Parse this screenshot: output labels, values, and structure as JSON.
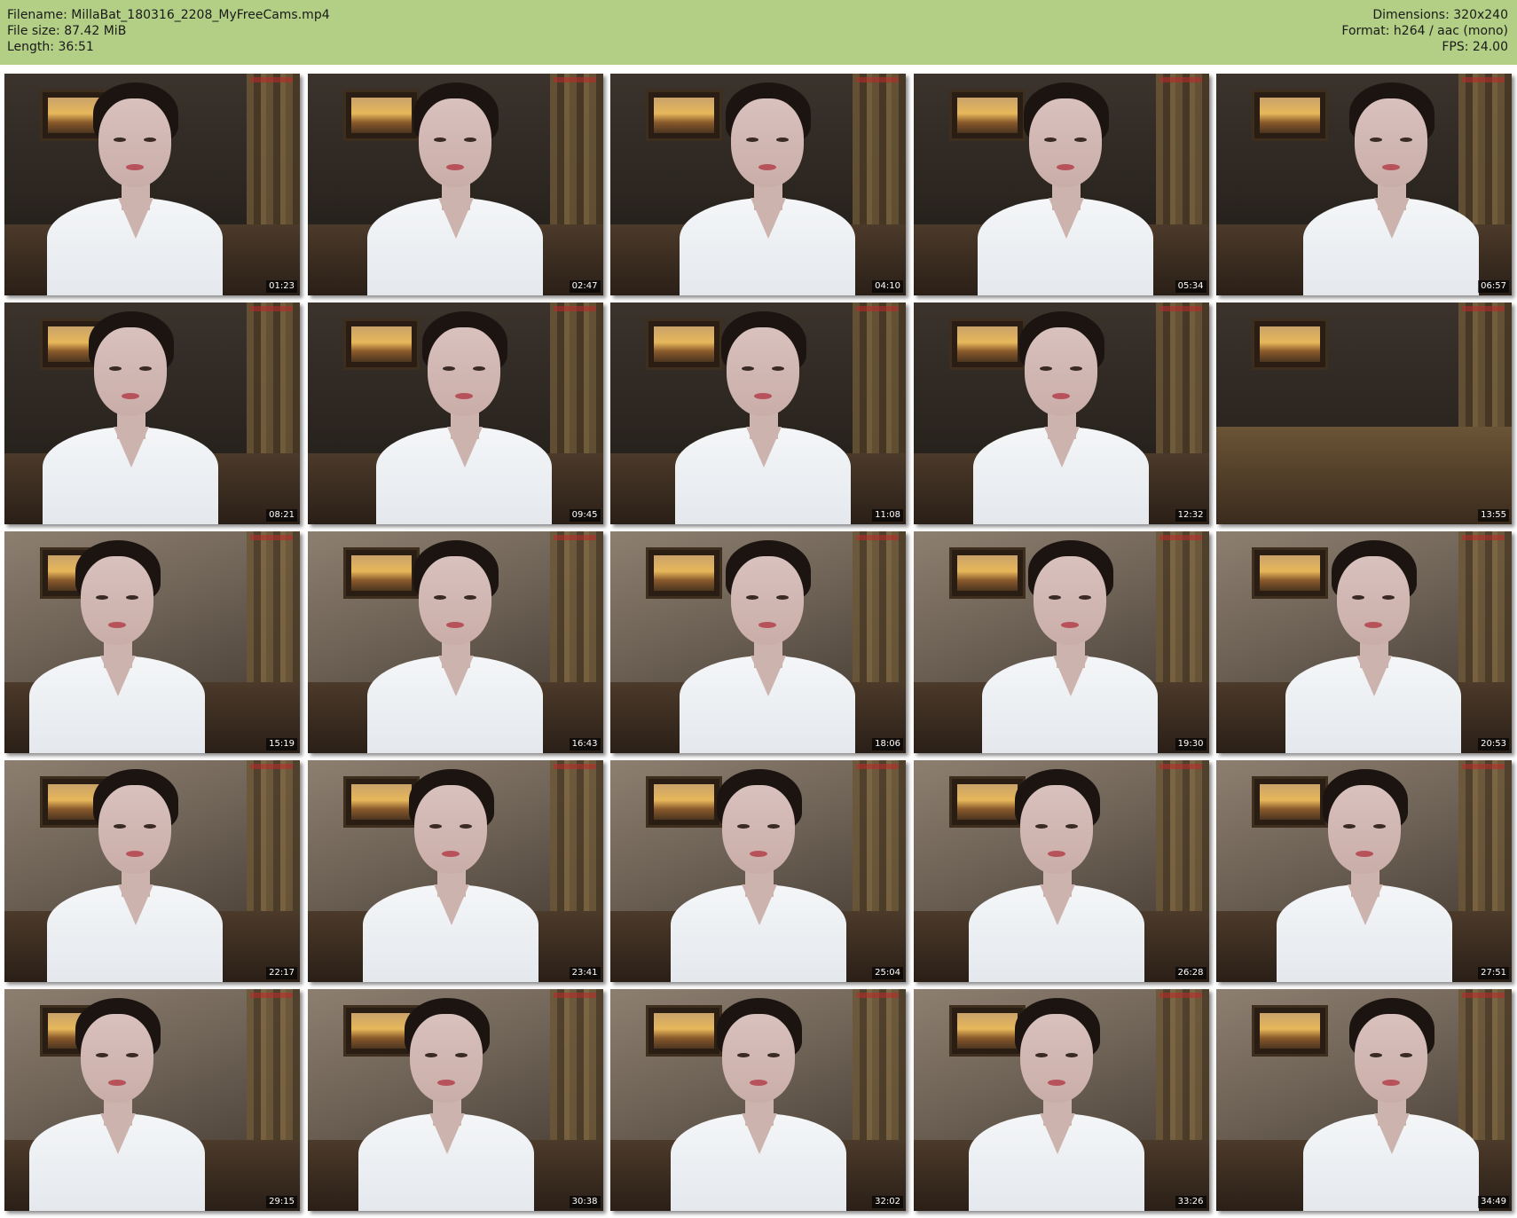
{
  "header": {
    "filename": "Filename: MillaBat_180316_2208_MyFreeCams.mp4",
    "file_size": "File size: 87.42 MiB",
    "length": "Length: 36:51",
    "dimensions": "Dimensions: 320x240",
    "format": "Format: h264 / aac (mono)",
    "fps": "FPS: 24.00"
  },
  "colors": {
    "header_bg": "#b2cf85",
    "page_bg": "#ffffff"
  },
  "thumbnails": [
    {
      "time": "01:23"
    },
    {
      "time": "02:47"
    },
    {
      "time": "04:10"
    },
    {
      "time": "05:34"
    },
    {
      "time": "06:57"
    },
    {
      "time": "08:21"
    },
    {
      "time": "09:45"
    },
    {
      "time": "11:08"
    },
    {
      "time": "12:32"
    },
    {
      "time": "13:55",
      "empty": true
    },
    {
      "time": "15:19"
    },
    {
      "time": "16:43"
    },
    {
      "time": "18:06"
    },
    {
      "time": "19:30"
    },
    {
      "time": "20:53"
    },
    {
      "time": "22:17"
    },
    {
      "time": "23:41"
    },
    {
      "time": "25:04"
    },
    {
      "time": "26:28"
    },
    {
      "time": "27:51"
    },
    {
      "time": "29:15"
    },
    {
      "time": "30:38"
    },
    {
      "time": "32:02"
    },
    {
      "time": "33:26"
    },
    {
      "time": "34:49"
    }
  ]
}
